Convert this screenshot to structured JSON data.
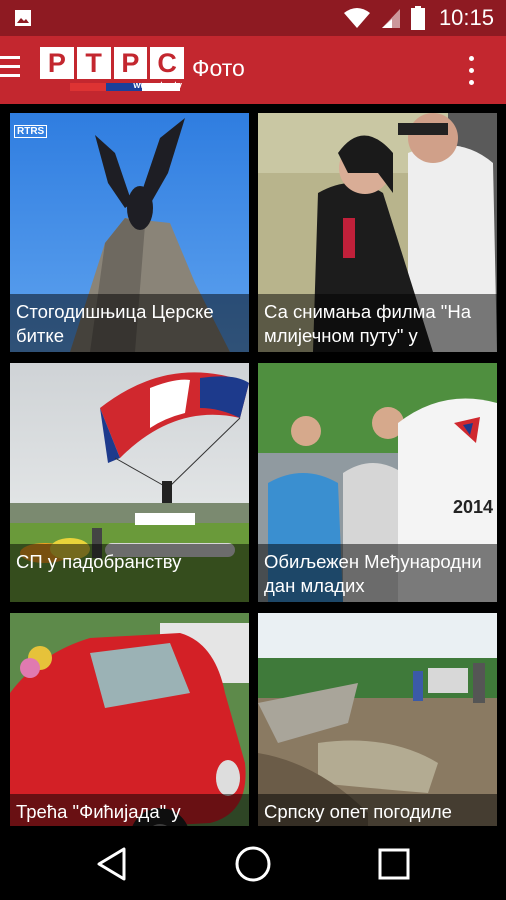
{
  "status_bar": {
    "time": "10:15",
    "icons": [
      "image-notification-icon",
      "wifi-icon",
      "cell-signal-icon",
      "battery-icon"
    ]
  },
  "app_bar": {
    "logo_text": [
      "Р",
      "Т",
      "Р",
      "С"
    ],
    "logo_url": "www.rtrs.tv",
    "title": "Фото",
    "menu_icon": "hamburger-menu-icon",
    "overflow_icon": "more-vert-icon"
  },
  "gallery": {
    "items": [
      {
        "caption": "Стогодишњица Церске битке",
        "badge": "RTRS"
      },
      {
        "caption": "Са снимања филма \"На млијечном путу\" у"
      },
      {
        "caption": "СП у падобранству"
      },
      {
        "caption": "Обиљежен Међународни дан младих"
      },
      {
        "caption": "Трећа \"Фићијада\" у"
      },
      {
        "caption": "Српску опет погодиле"
      }
    ]
  },
  "nav_bar": {
    "back": "back-icon",
    "home": "home-icon",
    "recents": "recents-icon"
  },
  "colors": {
    "status_bar": "#8e1a22",
    "app_bar": "#c3272f",
    "caption_overlay": "rgba(0,0,0,0.5)"
  }
}
